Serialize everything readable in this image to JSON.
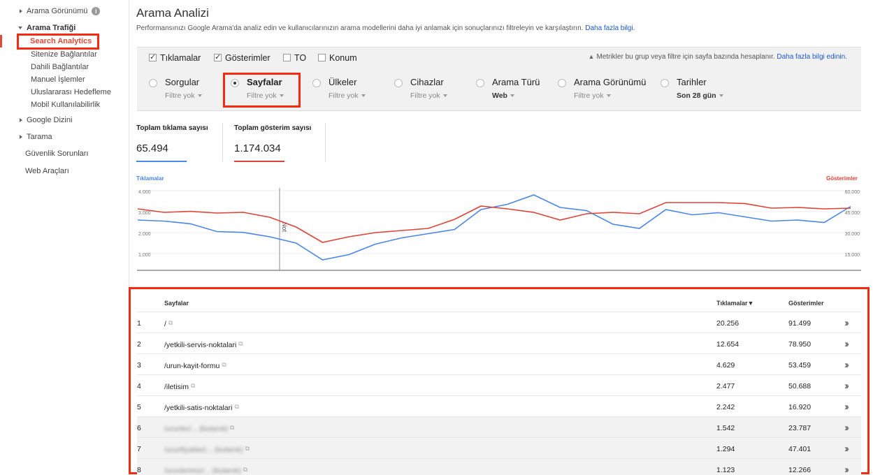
{
  "sidebar": {
    "items": [
      {
        "label": "Arama Görünümü",
        "info_icon": "i"
      },
      {
        "label": "Arama Trafiği"
      },
      {
        "label": "Search Analytics"
      },
      {
        "label": "Sitenize Bağlantılar"
      },
      {
        "label": "Dahili Bağlantılar"
      },
      {
        "label": "Manuel İşlemler"
      },
      {
        "label": "Uluslararası Hedefleme"
      },
      {
        "label": "Mobil Kullanılabilirlik"
      },
      {
        "label": "Google Dizini"
      },
      {
        "label": "Tarama"
      },
      {
        "label": "Güvenlik Sorunları"
      },
      {
        "label": "Web Araçları"
      }
    ]
  },
  "header": {
    "title": "Arama Analizi",
    "description": "Performansınızı Google Arama'da analiz edin ve kullanıcılarınızın arama modellerini daha iyi anlamak için sonuçlarınızı filtreleyin ve karşılaştırın.",
    "learn_more": "Daha fazla bilgi."
  },
  "metrics": {
    "items": [
      {
        "label": "Tıklamalar",
        "checked": true
      },
      {
        "label": "Gösterimler",
        "checked": true
      },
      {
        "label": "TO",
        "checked": false
      },
      {
        "label": "Konum",
        "checked": false
      }
    ],
    "note": "Metrikler bu grup veya filtre için sayfa bazında hesaplanır.",
    "note_link": "Daha fazla bilgi edinin."
  },
  "dimensions": [
    {
      "label": "Sorgular",
      "sub": "Filtre yok",
      "selected": false
    },
    {
      "label": "Sayfalar",
      "sub": "Filtre yok",
      "selected": true
    },
    {
      "label": "Ülkeler",
      "sub": "Filtre yok",
      "selected": false
    },
    {
      "label": "Cihazlar",
      "sub": "Filtre yok",
      "selected": false
    },
    {
      "label": "Arama Türü",
      "sub": "Web",
      "selected": false
    },
    {
      "label": "Arama Görünümü",
      "sub": "Filtre yok",
      "selected": false
    },
    {
      "label": "Tarihler",
      "sub": "Son 28 gün",
      "selected": false
    }
  ],
  "totals": {
    "clicks_label": "Toplam tıklama sayısı",
    "clicks_value": "65.494",
    "impressions_label": "Toplam gösterim sayısı",
    "impressions_value": "1.174.034"
  },
  "colors": {
    "clicks": "#4a86e8",
    "impressions": "#db4437",
    "highlight": "#f22b12"
  },
  "chart_data": {
    "type": "line",
    "left_axis_label": "Tıklamalar",
    "right_axis_label": "Gösterimler",
    "left_ticks": [
      "4.000",
      "3.000",
      "2.000",
      "1.000"
    ],
    "right_ticks": [
      "60.000",
      "45.000",
      "30.000",
      "15.000"
    ],
    "left_tick_values": [
      4000,
      3000,
      2000,
      1000
    ],
    "right_tick_values": [
      60000,
      45000,
      30000,
      15000
    ],
    "annotation": "Not",
    "annotation_index": 5,
    "series": [
      {
        "name": "Tıklamalar",
        "axis": "left",
        "values": [
          2600,
          2550,
          2420,
          2050,
          2010,
          1800,
          1500,
          700,
          950,
          1450,
          1750,
          1950,
          2150,
          3100,
          3350,
          3800,
          3200,
          3050,
          2400,
          2200,
          3100,
          2850,
          2950,
          2750,
          2550,
          2600,
          2480,
          3250
        ]
      },
      {
        "name": "Gösterimler",
        "axis": "right",
        "values": [
          47000,
          44500,
          45200,
          44000,
          44500,
          41000,
          34000,
          23000,
          27000,
          30000,
          31500,
          33000,
          39500,
          49000,
          47000,
          44500,
          39000,
          43500,
          44500,
          43500,
          51500,
          51500,
          51500,
          50800,
          47500,
          48000,
          47000,
          47500
        ]
      }
    ]
  },
  "table": {
    "headers": {
      "pages": "Sayfalar",
      "clicks": "Tıklamalar",
      "sort_indicator": "▼",
      "impressions": "Gösterimler"
    },
    "rows": [
      {
        "rank": "1",
        "page": "/",
        "clicks": "20.256",
        "impressions": "91.499",
        "blurred": false
      },
      {
        "rank": "2",
        "page": "/yetkili-servis-noktalari",
        "clicks": "12.654",
        "impressions": "78.950",
        "blurred": false
      },
      {
        "rank": "3",
        "page": "/urun-kayit-formu",
        "clicks": "4.629",
        "impressions": "53.459",
        "blurred": false
      },
      {
        "rank": "4",
        "page": "/iletisim",
        "clicks": "2.477",
        "impressions": "50.688",
        "blurred": false
      },
      {
        "rank": "5",
        "page": "/yetkili-satis-noktalari",
        "clicks": "2.242",
        "impressions": "16.920",
        "blurred": false
      },
      {
        "rank": "6",
        "page": "/urunler/... (bulanık)",
        "clicks": "1.542",
        "impressions": "23.787",
        "blurred": true
      },
      {
        "rank": "7",
        "page": "/urunfiyatlari/... (bulanık)",
        "clicks": "1.294",
        "impressions": "47.401",
        "blurred": true
      },
      {
        "rank": "8",
        "page": "/urunlerimiz/... (bulanık)",
        "clicks": "1.123",
        "impressions": "12.266",
        "blurred": true
      }
    ]
  }
}
